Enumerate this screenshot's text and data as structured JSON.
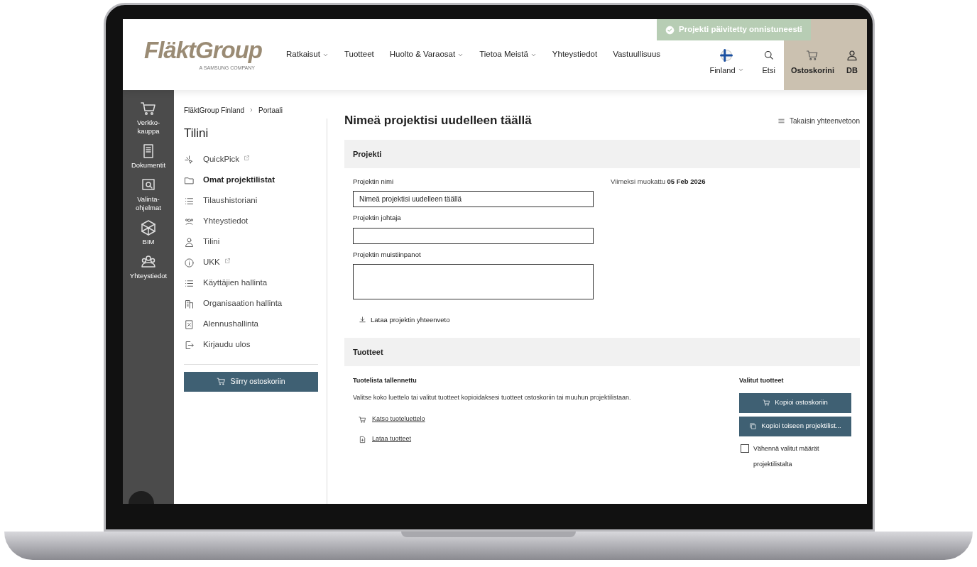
{
  "header": {
    "logo": "FläktGroup",
    "logo_tagline": "A SAMSUNG COMPANY",
    "nav": [
      {
        "label": "Ratkaisut",
        "dropdown": true
      },
      {
        "label": "Tuotteet",
        "dropdown": false
      },
      {
        "label": "Huolto & Varaosat",
        "dropdown": true
      },
      {
        "label": "Tietoa Meistä",
        "dropdown": true
      },
      {
        "label": "Yhteystiedot",
        "dropdown": false
      },
      {
        "label": "Vastuullisuus",
        "dropdown": false
      }
    ],
    "country": "Finland",
    "search": "Etsi",
    "cart": "Ostoskorini",
    "user": "DB"
  },
  "toast": "Projekti päivitetty onnistuneesti",
  "rail": [
    {
      "label": "Verkko-kauppa"
    },
    {
      "label": "Dokumentit"
    },
    {
      "label": "Valinta-ohjelmat"
    },
    {
      "label": "BIM"
    },
    {
      "label": "Yhteystiedot"
    }
  ],
  "breadcrumb": [
    "FläktGroup Finland",
    "Portaali"
  ],
  "sidebar": {
    "title": "Tilini",
    "items": [
      {
        "label": "QuickPick",
        "external": true,
        "selected": false
      },
      {
        "label": "Omat projektilistat",
        "external": false,
        "selected": true
      },
      {
        "label": "Tilaushistoriani",
        "external": false,
        "selected": false
      },
      {
        "label": "Yhteystiedot",
        "external": false,
        "selected": false
      },
      {
        "label": "Tilini",
        "external": false,
        "selected": false
      },
      {
        "label": "UKK",
        "external": true,
        "selected": false
      },
      {
        "label": "Käyttäjien hallinta",
        "external": false,
        "selected": false
      },
      {
        "label": "Organisaation hallinta",
        "external": false,
        "selected": false
      },
      {
        "label": "Alennushallinta",
        "external": false,
        "selected": false
      },
      {
        "label": "Kirjaudu ulos",
        "external": false,
        "selected": false
      }
    ],
    "button": "Siirry ostoskoriin"
  },
  "main": {
    "title": "Nimeä projektisi uudelleen täällä",
    "back_link": "Takaisin yhteenvetoon",
    "project": {
      "heading": "Projekti",
      "fields": [
        {
          "label": "Projektin nimi",
          "kind": "input",
          "value": "Nimeä projektisi uudelleen täällä"
        },
        {
          "label": "Projektin johtaja",
          "kind": "input"
        },
        {
          "label": "Projektin muistiinpanot",
          "kind": "textarea"
        }
      ],
      "modified_label": "Viimeksi muokattu",
      "modified_date": "05 Feb 2026",
      "download": "Lataa projektin yhteenveto"
    },
    "products": {
      "heading": "Tuotteet",
      "saved": "Tuotelista tallennettu",
      "description": "Valitse koko luettelo tai valitut tuotteet kopioidaksesi tuotteet ostoskoriin tai muuhun projektilistaan.",
      "links": [
        "Katso tuoteluettelo",
        "Lataa tuotteet"
      ],
      "selected_heading": "Valitut tuotteet",
      "buttons": [
        "Kopioi ostoskoriin",
        "Kopioi toiseen projektilist..."
      ],
      "reduce": {
        "label": "Vähennä valitut määrät projektilistalta",
        "checked": false
      }
    }
  }
}
